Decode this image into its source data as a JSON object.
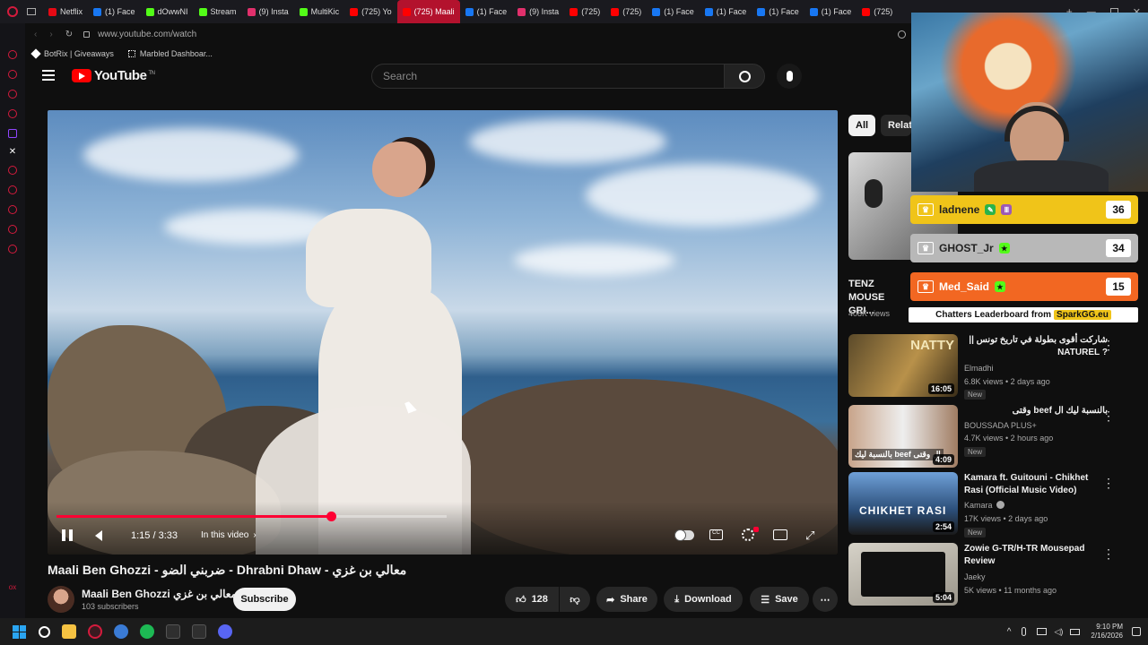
{
  "browser": {
    "tabs": [
      {
        "label": "Netflix",
        "color": "#e50914"
      },
      {
        "label": "(1) Face",
        "color": "#1877f2"
      },
      {
        "label": "dOwwNI",
        "color": "#53fc18"
      },
      {
        "label": "Stream",
        "color": "#53fc18"
      },
      {
        "label": "(9) Insta",
        "color": "#e1306c"
      },
      {
        "label": "MultiKic",
        "color": "#53fc18"
      },
      {
        "label": "(725) Yo",
        "color": "#ff0000"
      },
      {
        "label": "(725) Maali",
        "color": "#ff0000",
        "active": true
      },
      {
        "label": "(1) Face",
        "color": "#1877f2"
      },
      {
        "label": "(9) Insta",
        "color": "#e1306c"
      },
      {
        "label": "(725)",
        "color": "#ff0000"
      },
      {
        "label": "(725)",
        "color": "#ff0000"
      },
      {
        "label": "(1) Face",
        "color": "#1877f2"
      },
      {
        "label": "(1) Face",
        "color": "#1877f2"
      },
      {
        "label": "(1) Face",
        "color": "#1877f2"
      },
      {
        "label": "(1) Face",
        "color": "#1877f2"
      },
      {
        "label": "(725)",
        "color": "#ff0000"
      }
    ],
    "url": "www.youtube.com/watch",
    "bookmarks": [
      {
        "label": "BotRix | Giveaways"
      },
      {
        "label": "Marbled Dashboar..."
      }
    ]
  },
  "youtube": {
    "logo_text": "YouTube",
    "logo_sup": "TN",
    "search_placeholder": "Search",
    "player": {
      "time": "1:15 / 3:33",
      "in_this_video": "In this video",
      "progress": 0.352
    },
    "video_title": "Maali Ben Ghozzi - ضربني الضو - Dhrabni Dhaw - معالي بن غزي",
    "channel": {
      "name": "Maali Ben Ghozzi معالي بن غزي",
      "subscribers": "103 subscribers",
      "subscribe_label": "Subscribe"
    },
    "actions": {
      "likes": "128",
      "share": "Share",
      "download": "Download",
      "save": "Save"
    },
    "chips": [
      "All",
      "Relate"
    ],
    "recommendations": [
      {
        "title": "TENZ MOUSE GRI...",
        "meta": "408K views"
      },
      {
        "title": "شاركت أقوى بطولة في تاريخ تونس || ? NATUREL",
        "channel": "Elmadhi",
        "meta": "6.8K views • 2 days ago",
        "new": "New",
        "duration": "16:05",
        "thumb_text": "NATTY"
      },
      {
        "title": "بالنسبة ليك ال beef وقتى",
        "channel": "BOUSSADA PLUS+",
        "meta": "4.7K views • 2 hours ago",
        "new": "New",
        "duration": "4:09",
        "thumb_text": "بالنسبة ليك beef ال وقتى"
      },
      {
        "title": "Kamara ft. Guitouni - Chikhet Rasi (Official Music Video)",
        "channel": "Kamara",
        "meta": "17K views • 2 days ago",
        "new": "New",
        "duration": "2:54",
        "thumb_text": "CHIKHET RASI"
      },
      {
        "title": "Zowie G-TR/H-TR Mousepad Review",
        "channel": "Jaeky",
        "meta": "5K views • 11 months ago",
        "duration": "5:04"
      }
    ]
  },
  "leaderboard": {
    "rows": [
      {
        "name": "ladnene",
        "score": "36",
        "color": "#f0c419"
      },
      {
        "name": "GHOST_Jr",
        "score": "34",
        "color": "#b8b8b8"
      },
      {
        "name": "Med_Said",
        "score": "15",
        "color": "#f26722"
      }
    ],
    "footer_prefix": "Chatters Leaderboard from",
    "footer_brand": "SparkGG.eu"
  },
  "taskbar": {
    "time": "9:10 PM",
    "date": "2/16/2026"
  }
}
